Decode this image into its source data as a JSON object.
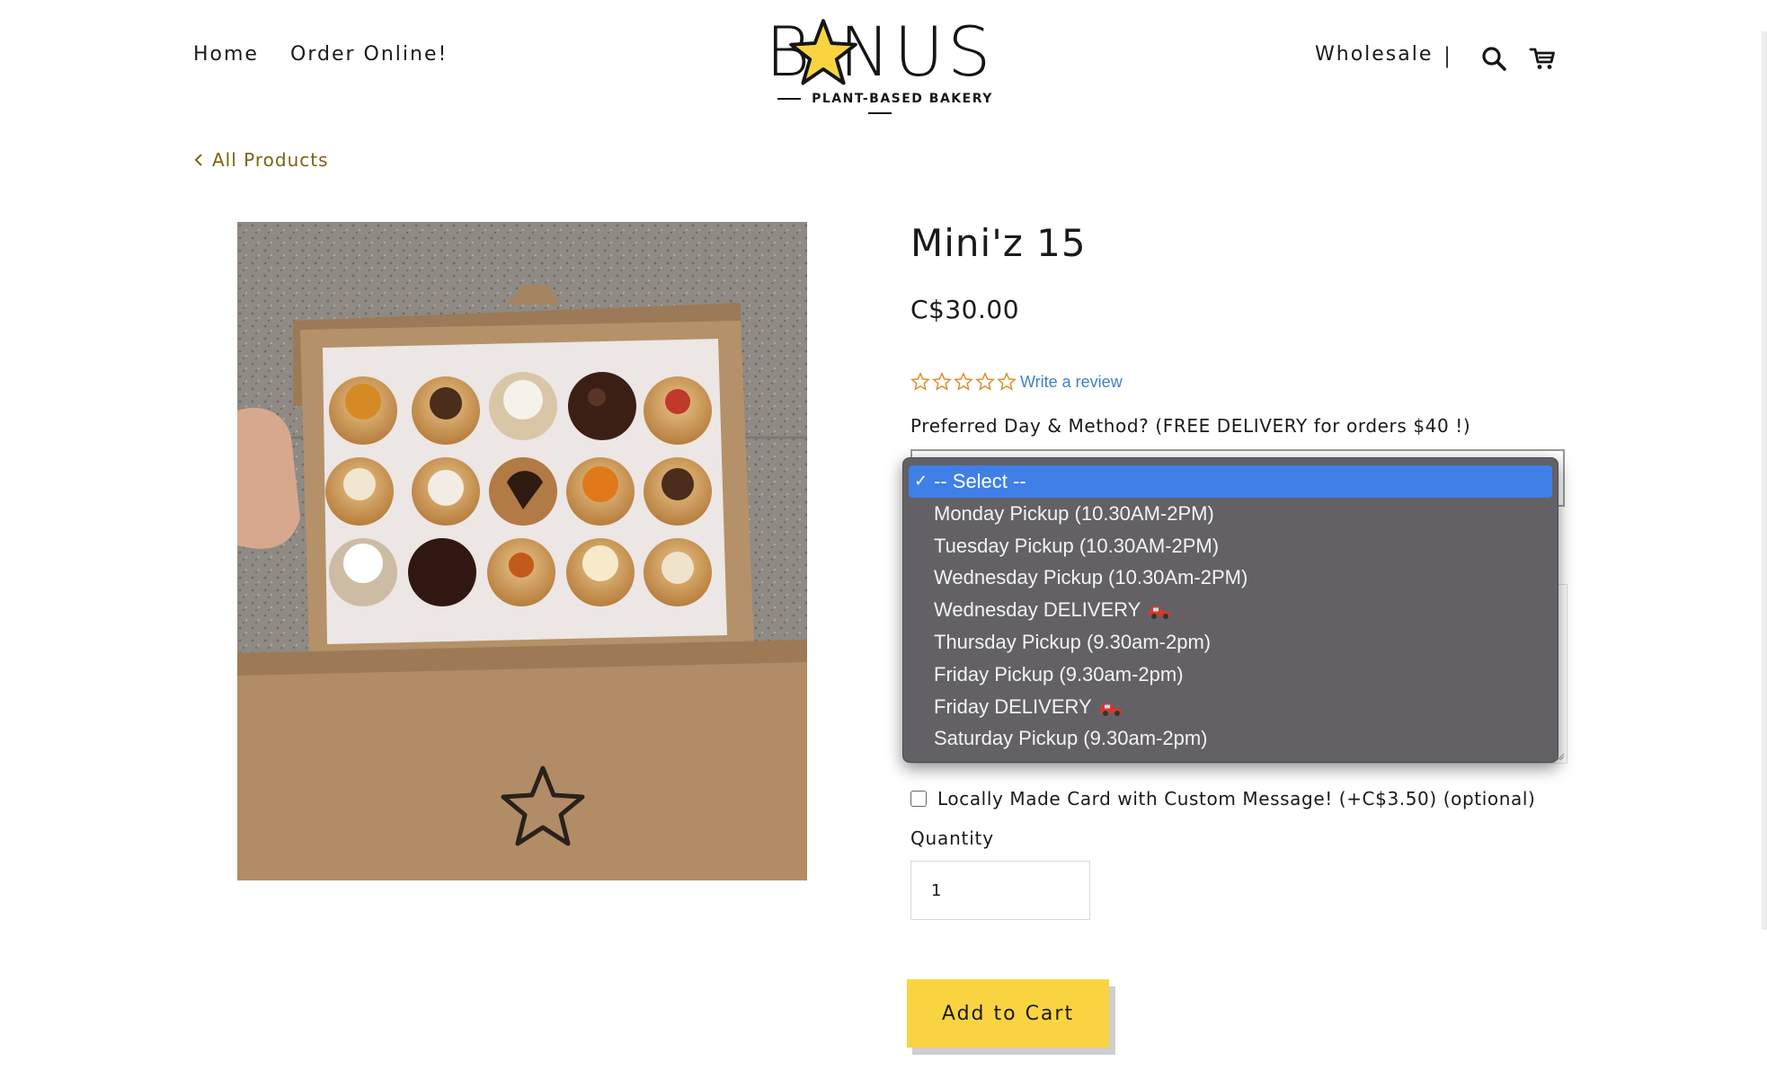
{
  "nav": {
    "home": "Home",
    "order_online": "Order Online!",
    "wholesale": "Wholesale",
    "divider": "|",
    "search_icon": "search-icon",
    "cart_icon": "cart-icon"
  },
  "logo": {
    "word": "B  NUS",
    "subtitle": "PLANT-BASED BAKERY",
    "star_color": "#fad440"
  },
  "breadcrumb": {
    "back_label": "All Products"
  },
  "product": {
    "title": "Mini'z 15",
    "price": "C$30.00",
    "rating": 0,
    "rating_max": 5,
    "write_review": "Write a review",
    "image_icon": "product-photo"
  },
  "options": {
    "preferred_label": "Preferred Day & Method? (FREE DELIVERY for orders $40 !)",
    "dropdown": [
      {
        "label": "-- Select --",
        "selected": true,
        "car": false
      },
      {
        "label": "Monday Pickup (10.30AM-2PM)",
        "selected": false,
        "car": false
      },
      {
        "label": "Tuesday Pickup (10.30AM-2PM)",
        "selected": false,
        "car": false
      },
      {
        "label": "Wednesday Pickup (10.30Am-2PM)",
        "selected": false,
        "car": false
      },
      {
        "label": "Wednesday DELIVERY",
        "selected": false,
        "car": true
      },
      {
        "label": "Thursday Pickup (9.30am-2pm)",
        "selected": false,
        "car": false
      },
      {
        "label": "Friday Pickup (9.30am-2pm)",
        "selected": false,
        "car": false
      },
      {
        "label": "Friday DELIVERY",
        "selected": false,
        "car": true
      },
      {
        "label": "Saturday Pickup (9.30am-2pm)",
        "selected": false,
        "car": false
      }
    ],
    "card_label": "Locally Made Card with Custom Message! (+C$3.50) (optional)",
    "quantity_label": "Quantity",
    "quantity_value": "1"
  },
  "cart": {
    "add_label": "Add to Cart",
    "button_color": "#fad440"
  },
  "colors": {
    "accent_link": "#7a6412",
    "review_link": "#3d7fd3",
    "select_highlight": "#3f7fe8",
    "dropdown_bg": "#636166"
  }
}
